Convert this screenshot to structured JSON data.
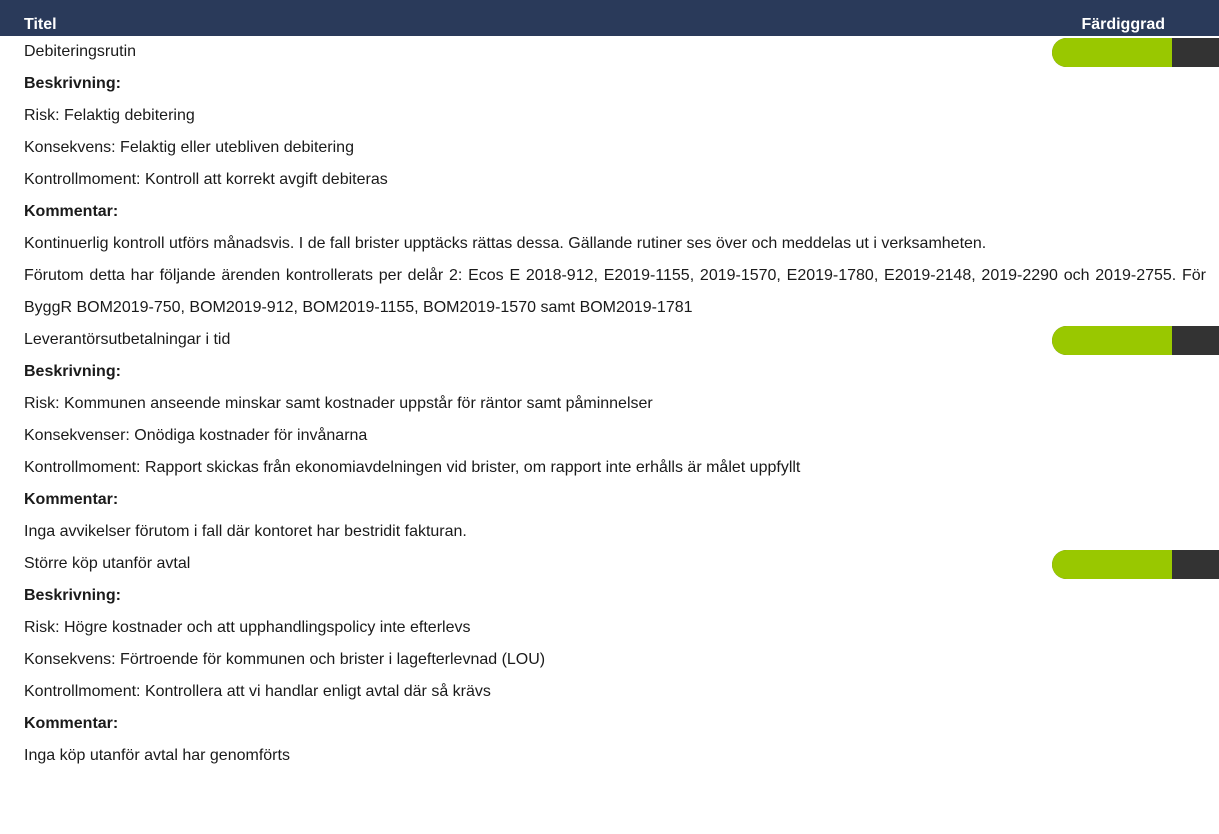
{
  "header": {
    "title": "Titel",
    "progress": "Färdiggrad"
  },
  "colors": {
    "header_bg": "#2a3a5a",
    "progress_fill": "#99c800",
    "progress_remaining": "#333333"
  },
  "items": [
    {
      "title": "Debiteringsrutin",
      "progress_fraction": 0.72,
      "beskrivning_label": "Beskrivning:",
      "lines": [
        "Risk: Felaktig debitering",
        "Konsekvens: Felaktig eller utebliven debitering",
        "Kontrollmoment: Kontroll att korrekt avgift debiteras"
      ],
      "kommentar_label": "Kommentar:",
      "comments": [
        "Kontinuerlig kontroll utförs månadsvis. I de fall brister upptäcks rättas dessa. Gällande rutiner ses över och meddelas ut i verksamheten.",
        "Förutom detta har följande ärenden kontrollerats per delår 2: Ecos E 2018-912, E2019-1155, 2019-1570, E2019-1780, E2019-2148, 2019-2290 och 2019-2755. För ByggR BOM2019-750, BOM2019-912, BOM2019-1155, BOM2019-1570 samt BOM2019-1781"
      ]
    },
    {
      "title": "Leverantörsutbetalningar i tid",
      "progress_fraction": 0.72,
      "beskrivning_label": "Beskrivning:",
      "lines": [
        "Risk: Kommunen anseende minskar samt kostnader uppstår för räntor samt påminnelser",
        "Konsekvenser: Onödiga kostnader för invånarna",
        "Kontrollmoment: Rapport skickas från ekonomiavdelningen vid brister, om rapport inte erhålls är målet uppfyllt"
      ],
      "kommentar_label": "Kommentar:",
      "comments": [
        "Inga avvikelser förutom i fall där kontoret har bestridit fakturan."
      ]
    },
    {
      "title": "Större köp utanför avtal",
      "progress_fraction": 0.72,
      "beskrivning_label": "Beskrivning:",
      "lines": [
        "Risk: Högre kostnader och att upphandlingspolicy inte efterlevs",
        "Konsekvens: Förtroende för kommunen och brister i lagefterlevnad (LOU)",
        "Kontrollmoment: Kontrollera att vi handlar enligt avtal där så krävs"
      ],
      "kommentar_label": "Kommentar:",
      "comments": [
        "Inga köp utanför avtal har genomförts"
      ]
    }
  ]
}
